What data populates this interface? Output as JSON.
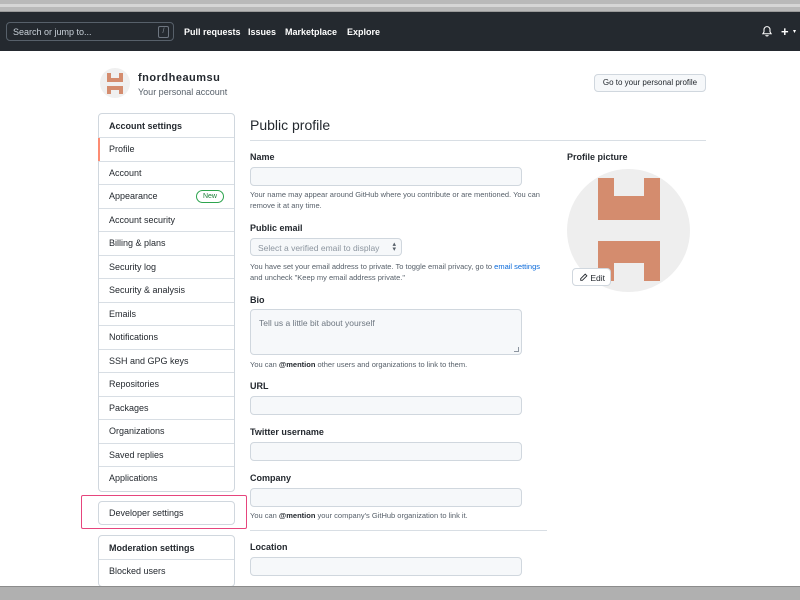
{
  "header": {
    "search_placeholder": "Search or jump to...",
    "search_shortcut": "/",
    "nav": [
      "Pull requests",
      "Issues",
      "Marketplace",
      "Explore"
    ],
    "plus": "+",
    "plus_caret": "▾"
  },
  "account": {
    "name": "fnordheaumsu",
    "subtitle": "Your personal account",
    "profile_button": "Go to your personal profile"
  },
  "sidebar": {
    "heading": "Account settings",
    "items": [
      {
        "label": "Profile",
        "active": true
      },
      {
        "label": "Account"
      },
      {
        "label": "Appearance",
        "badge": "New"
      },
      {
        "label": "Account security"
      },
      {
        "label": "Billing & plans"
      },
      {
        "label": "Security log"
      },
      {
        "label": "Security & analysis"
      },
      {
        "label": "Emails"
      },
      {
        "label": "Notifications"
      },
      {
        "label": "SSH and GPG keys"
      },
      {
        "label": "Repositories"
      },
      {
        "label": "Packages"
      },
      {
        "label": "Organizations"
      },
      {
        "label": "Saved replies"
      },
      {
        "label": "Applications"
      }
    ],
    "developer_settings": "Developer settings",
    "moderation_heading": "Moderation settings",
    "moderation_items": [
      "Blocked users"
    ]
  },
  "main": {
    "title": "Public profile",
    "name_label": "Name",
    "name_value": "",
    "name_note": "Your name may appear around GitHub where you contribute or are mentioned. You can remove it at any time.",
    "email_label": "Public email",
    "email_select": "Select a verified email to display",
    "email_note_1": "You have set your email address to private. To toggle email privacy, go to ",
    "email_note_link": "email settings",
    "email_note_2": " and uncheck \"Keep my email address private.\"",
    "bio_label": "Bio",
    "bio_placeholder": "Tell us a little bit about yourself",
    "bio_note_1": "You can ",
    "bio_note_mention": "@mention",
    "bio_note_2": " other users and organizations to link to them.",
    "url_label": "URL",
    "twitter_label": "Twitter username",
    "company_label": "Company",
    "company_note_1": "You can ",
    "company_note_mention": "@mention",
    "company_note_2": " your company's GitHub organization to link it.",
    "location_label": "Location"
  },
  "picture": {
    "label": "Profile picture",
    "edit": "Edit"
  },
  "colors": {
    "header_bg": "#24292f",
    "identicon": "#d48c6e",
    "accent_active": "#fd8c73",
    "link": "#0969da",
    "highlight_box": "#e6457d",
    "badge_green": "#1a7f37"
  },
  "icons": [
    "bell-icon",
    "plus-icon",
    "pencil-icon",
    "identicon-avatar"
  ]
}
